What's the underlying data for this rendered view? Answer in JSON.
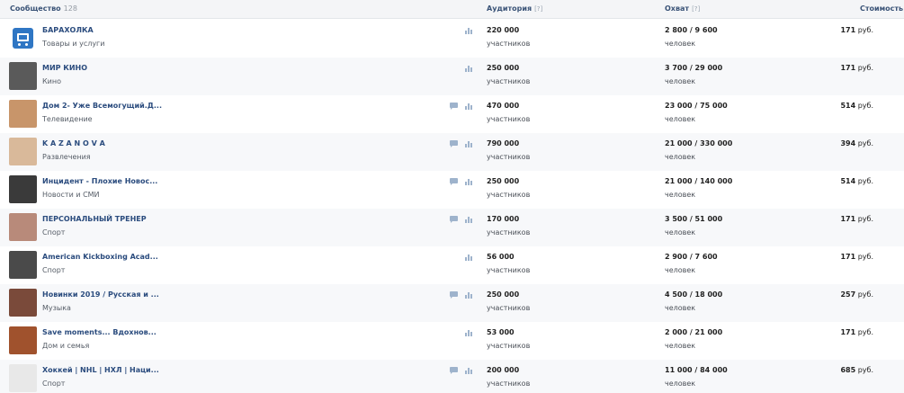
{
  "header": {
    "community_label": "Сообщество",
    "community_count": "128",
    "audience_label": "Аудитория",
    "audience_help": "[?]",
    "reach_label": "Охват",
    "reach_help": "[?]",
    "cost_label": "Стоимость",
    "cost_help": "[?]"
  },
  "rows": [
    {
      "name": "БАРАХОЛКА",
      "category": "Товары и услуги",
      "audience": "220 000",
      "audience_unit": "участников",
      "reach": "2 800 / 9 600",
      "reach_unit": "человек",
      "price": "171",
      "currency": "руб.",
      "icons": [
        "chart-icon"
      ]
    },
    {
      "name": "МИР КИНО",
      "category": "Кино",
      "audience": "250 000",
      "audience_unit": "участников",
      "reach": "3 700 / 29 000",
      "reach_unit": "человек",
      "price": "171",
      "currency": "руб.",
      "icons": [
        "chart-icon"
      ]
    },
    {
      "name": "Дом 2- Уже Всемогущий.Д...",
      "category": "Телевидение",
      "audience": "470 000",
      "audience_unit": "участников",
      "reach": "23 000 / 75 000",
      "reach_unit": "человек",
      "price": "514",
      "currency": "руб.",
      "icons": [
        "message-icon",
        "chart-icon"
      ]
    },
    {
      "name": "K A Z A N O V A",
      "category": "Развлечения",
      "audience": "790 000",
      "audience_unit": "участников",
      "reach": "21 000 / 330 000",
      "reach_unit": "человек",
      "price": "394",
      "currency": "руб.",
      "icons": [
        "message-icon",
        "chart-icon"
      ]
    },
    {
      "name": "Инцидент - Плохие Новос...",
      "category": "Новости и СМИ",
      "audience": "250 000",
      "audience_unit": "участников",
      "reach": "21 000 / 140 000",
      "reach_unit": "человек",
      "price": "514",
      "currency": "руб.",
      "icons": [
        "message-icon",
        "chart-icon"
      ]
    },
    {
      "name": "ПЕРСОНАЛЬНЫЙ ТРЕНЕР",
      "category": "Спорт",
      "audience": "170 000",
      "audience_unit": "участников",
      "reach": "3 500 / 51 000",
      "reach_unit": "человек",
      "price": "171",
      "currency": "руб.",
      "icons": [
        "message-icon",
        "chart-icon"
      ]
    },
    {
      "name": "American Kickboxing Acad...",
      "category": "Спорт",
      "audience": "56 000",
      "audience_unit": "участников",
      "reach": "2 900 / 7 600",
      "reach_unit": "человек",
      "price": "171",
      "currency": "руб.",
      "icons": [
        "chart-icon"
      ]
    },
    {
      "name": "Новинки 2019 / Русская и ...",
      "category": "Музыка",
      "audience": "250 000",
      "audience_unit": "участников",
      "reach": "4 500 / 18 000",
      "reach_unit": "человек",
      "price": "257",
      "currency": "руб.",
      "icons": [
        "message-icon",
        "chart-icon"
      ]
    },
    {
      "name": "Save moments... Вдохнов...",
      "category": "Дом и семья",
      "audience": "53 000",
      "audience_unit": "участников",
      "reach": "2 000 / 21 000",
      "reach_unit": "человек",
      "price": "171",
      "currency": "руб.",
      "icons": [
        "chart-icon"
      ]
    },
    {
      "name": "Хоккей | NHL | НХЛ | Наци...",
      "category": "Спорт",
      "audience": "200 000",
      "audience_unit": "участников",
      "reach": "11 000 / 84 000",
      "reach_unit": "человек",
      "price": "685",
      "currency": "руб.",
      "icons": [
        "message-icon",
        "chart-icon"
      ]
    }
  ],
  "avatar_colors": [
    "#2f76c4",
    "#5a5a5a",
    "#c8956a",
    "#d9b99a",
    "#3a3a3a",
    "#b88a7a",
    "#4a4a4a",
    "#7a4a3a",
    "#a0522d",
    "#e8e8e8"
  ]
}
